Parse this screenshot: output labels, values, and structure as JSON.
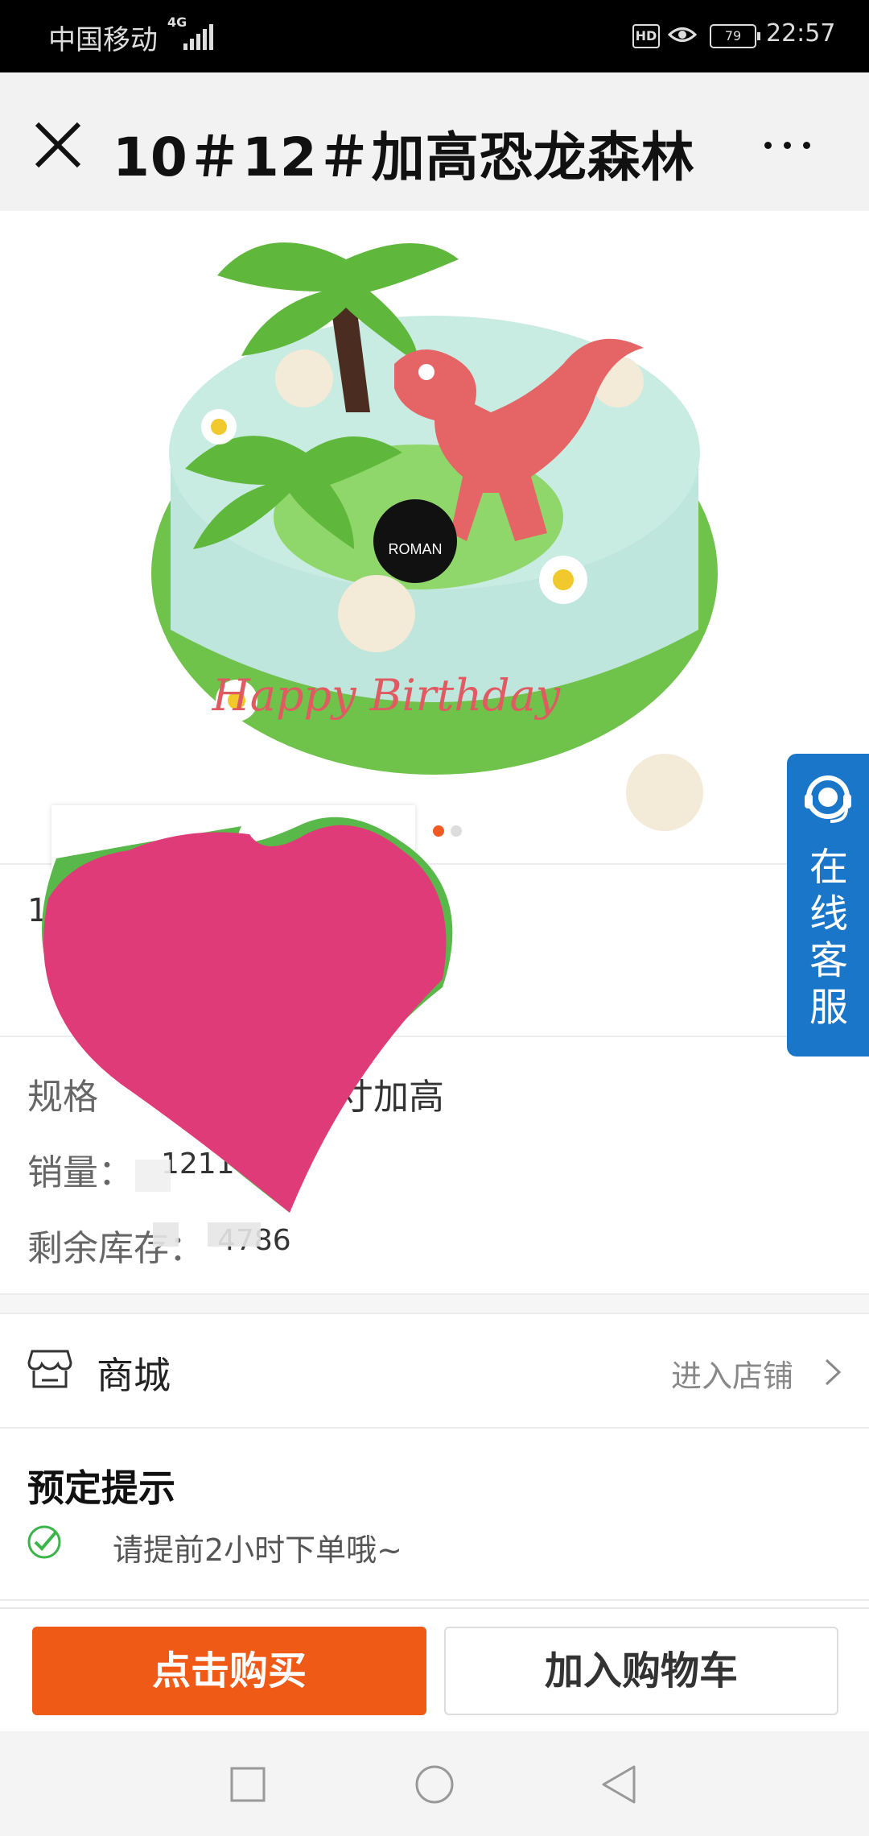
{
  "status_bar": {
    "carrier": "中国移动",
    "network": "4G",
    "hd": "HD",
    "battery": "79",
    "time": "22:57",
    "icons": [
      "signal-icon",
      "hd-icon",
      "eye-icon",
      "battery-icon"
    ]
  },
  "header": {
    "title": "10＃12＃加高恐龙森林",
    "icons": [
      "close-icon",
      "more-icon"
    ]
  },
  "product_image": {
    "cake_text": "Happy Birthday",
    "brand_badge": "ROMAN",
    "slides": 2,
    "active_slide": 1
  },
  "customer_service": {
    "label": "在线客服",
    "icon": "headset-icon",
    "color": "#1a76c9"
  },
  "details": {
    "price_partial": "1",
    "spec_label": "规格",
    "spec_value_partial": "寸加高",
    "sales_label": "销量：",
    "sales_value": "1211",
    "stock_label": "剩余库存：",
    "stock_value": "4786"
  },
  "shop": {
    "label": "商城",
    "enter_label": "进入店铺",
    "icons": [
      "shop-icon",
      "chevron-right-icon"
    ]
  },
  "booking_tips": {
    "title": "预定提示",
    "tip": "请提前2小时下单哦~",
    "icon": "check-circle-icon"
  },
  "actions": {
    "buy_label": "点击购买",
    "cart_label": "加入购物车",
    "accent": "#ef5a17"
  },
  "nav_bar": {
    "icons": [
      "recents-icon",
      "home-icon",
      "back-icon"
    ]
  },
  "overlay": {
    "scribble_color": "#df3b78"
  }
}
